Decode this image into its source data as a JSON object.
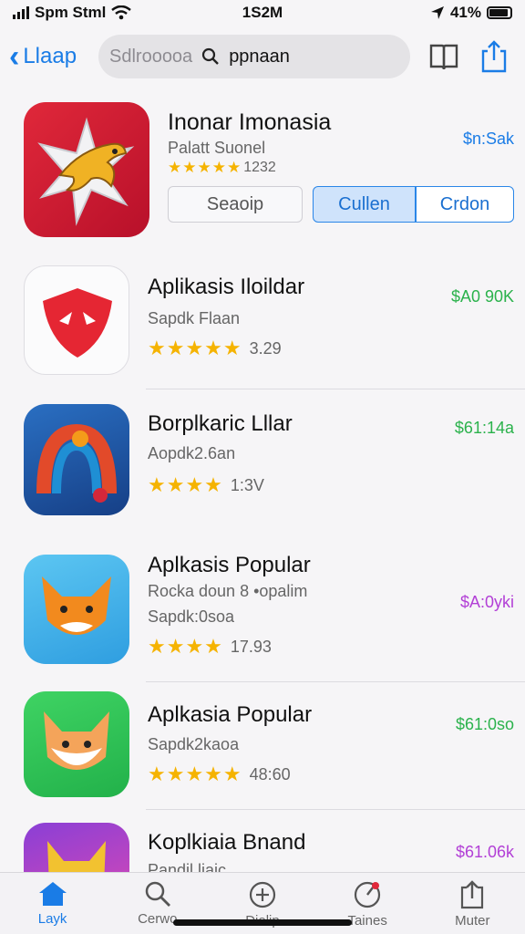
{
  "status_bar": {
    "carrier": "Spm Stml",
    "time": "1S2M",
    "battery": "41%"
  },
  "nav": {
    "back_label": "Llaap",
    "search_placeholder": "Sdlrooooa",
    "search_query": "ppnaan"
  },
  "colors": {
    "accent": "#1a7ce6",
    "star": "#f5b301",
    "price_blue": "#1a7ce6",
    "price_green": "#2bb24c",
    "price_purple": "#b23fd6"
  },
  "featured": {
    "name": "Inonar Imonasia",
    "developer": "Palatt Suonel",
    "stars": "★★★★★",
    "rating_count": "1232",
    "price": "$n:Sak",
    "buttons": {
      "plain": "Seaoip",
      "primary": "Cullen",
      "secondary": "Crdon"
    }
  },
  "apps": [
    {
      "name": "Aplikasis Iloildar",
      "line1": "Sapdk Flaan",
      "line2": "",
      "stars": "★★★★★",
      "count": "3.29",
      "price": "$A0 90K",
      "price_color": "#2bb24c",
      "icon": "shield-icon"
    },
    {
      "name": "Borplkaric Lllar",
      "line1": "Aopdk2.6an",
      "line2": "",
      "stars": "★★★★",
      "count": "1:3V",
      "price": "$61:14a",
      "price_color": "#2bb24c",
      "icon": "rainbow-icon"
    },
    {
      "name": "Aplkasis Popular",
      "line1": "Rocka doun 8 •opalim",
      "line2": "Sapdk:0soa",
      "stars": "★★★★",
      "count": "17.93",
      "price": "$A:0yki",
      "price_color": "#b23fd6",
      "icon": "fox-icon"
    },
    {
      "name": "Aplkasia Popular",
      "line1": "Sapdk2kaoa",
      "line2": "",
      "stars": "★★★★★",
      "count": "48:60",
      "price": "$61:0so",
      "price_color": "#2bb24c",
      "icon": "fox-icon"
    },
    {
      "name": "Koplkiaia Bnand",
      "line1": "Pandil liaic",
      "line2": "",
      "stars": "",
      "count": "",
      "price": "$61.06k",
      "price_color": "#b23fd6",
      "icon": "cat-icon"
    }
  ],
  "tabs": [
    {
      "label": "Layk",
      "icon": "home-icon"
    },
    {
      "label": "Cerwo",
      "icon": "search-icon"
    },
    {
      "label": "Diolip",
      "icon": "layers-icon"
    },
    {
      "label": "Taines",
      "icon": "gauge-icon"
    },
    {
      "label": "Muter",
      "icon": "download-icon"
    }
  ]
}
